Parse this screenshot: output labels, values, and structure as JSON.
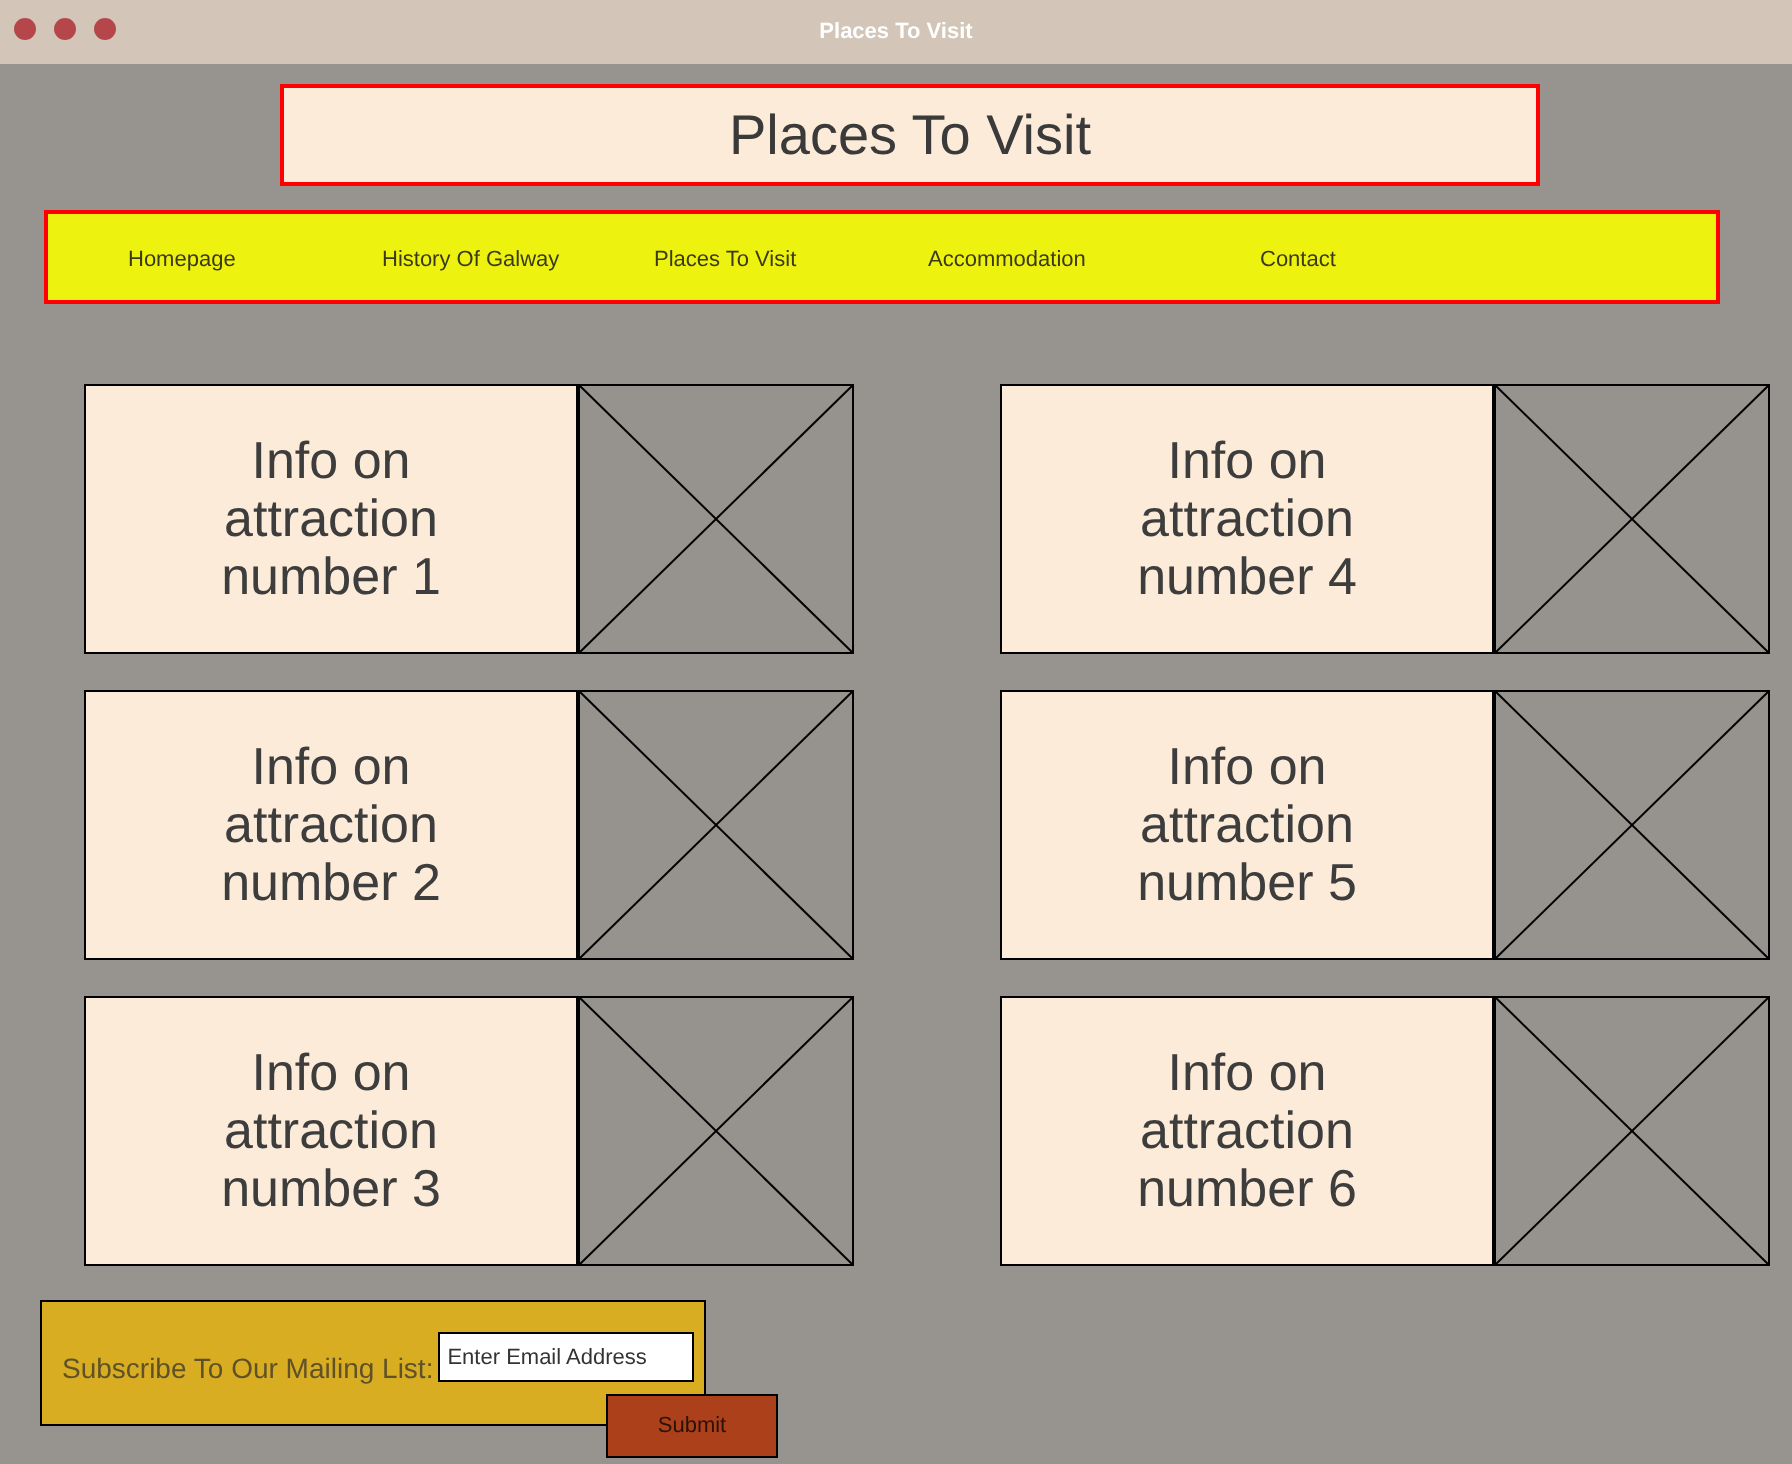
{
  "window": {
    "title": "Places To Visit"
  },
  "header": {
    "title": "Places To Visit"
  },
  "nav": {
    "items": [
      {
        "label": "Homepage"
      },
      {
        "label": "History Of Galway"
      },
      {
        "label": "Places To Visit"
      },
      {
        "label": "Accommodation"
      },
      {
        "label": "Contact"
      }
    ]
  },
  "attraction_columns": [
    {
      "cards": [
        {
          "text": "Info on attraction number 1"
        },
        {
          "text": "Info on attraction number 2"
        },
        {
          "text": "Info on attraction number 3"
        }
      ]
    },
    {
      "cards": [
        {
          "text": "Info on attraction number 4"
        },
        {
          "text": "Info on attraction number 5"
        },
        {
          "text": "Info on attraction number 6"
        }
      ]
    }
  ],
  "subscribe": {
    "label": "Subscribe To Our Mailing List:",
    "email_placeholder": "Enter Email Address",
    "button": "Submit"
  }
}
